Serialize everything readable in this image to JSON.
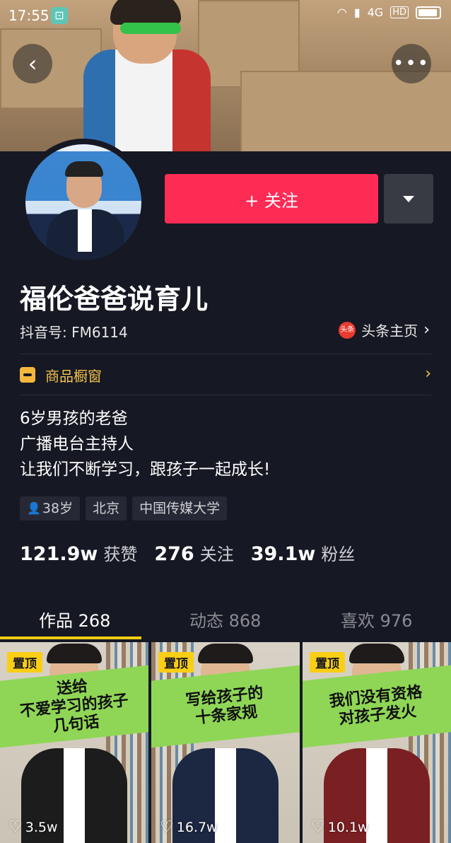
{
  "status_bar": {
    "time": "17:55",
    "network": "4G",
    "hd": "HD"
  },
  "profile": {
    "follow_label": "+ 关注",
    "name": "福伦爸爸说育儿",
    "douyin_id": "抖音号: FM6114",
    "toutiao_label": "头条主页",
    "toutiao_icon_text": "头条",
    "shop_label": "商品橱窗",
    "bio": [
      "6岁男孩的老爸",
      "广播电台主持人",
      "让我们不断学习，跟孩子一起成长!"
    ],
    "tags": [
      "38岁",
      "北京",
      "中国传媒大学"
    ],
    "stats": [
      {
        "value": "121.9w",
        "label": "获赞"
      },
      {
        "value": "276",
        "label": "关注"
      },
      {
        "value": "39.1w",
        "label": "粉丝"
      }
    ]
  },
  "tabs": [
    {
      "label": "作品 268",
      "active": true
    },
    {
      "label": "动态 868",
      "active": false
    },
    {
      "label": "喜欢 976",
      "active": false
    }
  ],
  "videos": [
    {
      "pin": "置顶",
      "title_lines": [
        "送给",
        "不爱学习的孩子",
        "几句话"
      ],
      "likes": "3.5w",
      "vest_color": "#1c1c1c"
    },
    {
      "pin": "置顶",
      "title_lines": [
        "写给孩子的",
        "十条家规"
      ],
      "likes": "16.7w",
      "vest_color": "#1c2741"
    },
    {
      "pin": "置顶",
      "title_lines": [
        "我们没有资格",
        "对孩子发火"
      ],
      "likes": "10.1w",
      "vest_color": "#7a1f22"
    }
  ],
  "colors": {
    "background": "#161823",
    "follow": "#fe2c55",
    "accent_yellow": "#face15",
    "banner_green": "#8fd656"
  }
}
